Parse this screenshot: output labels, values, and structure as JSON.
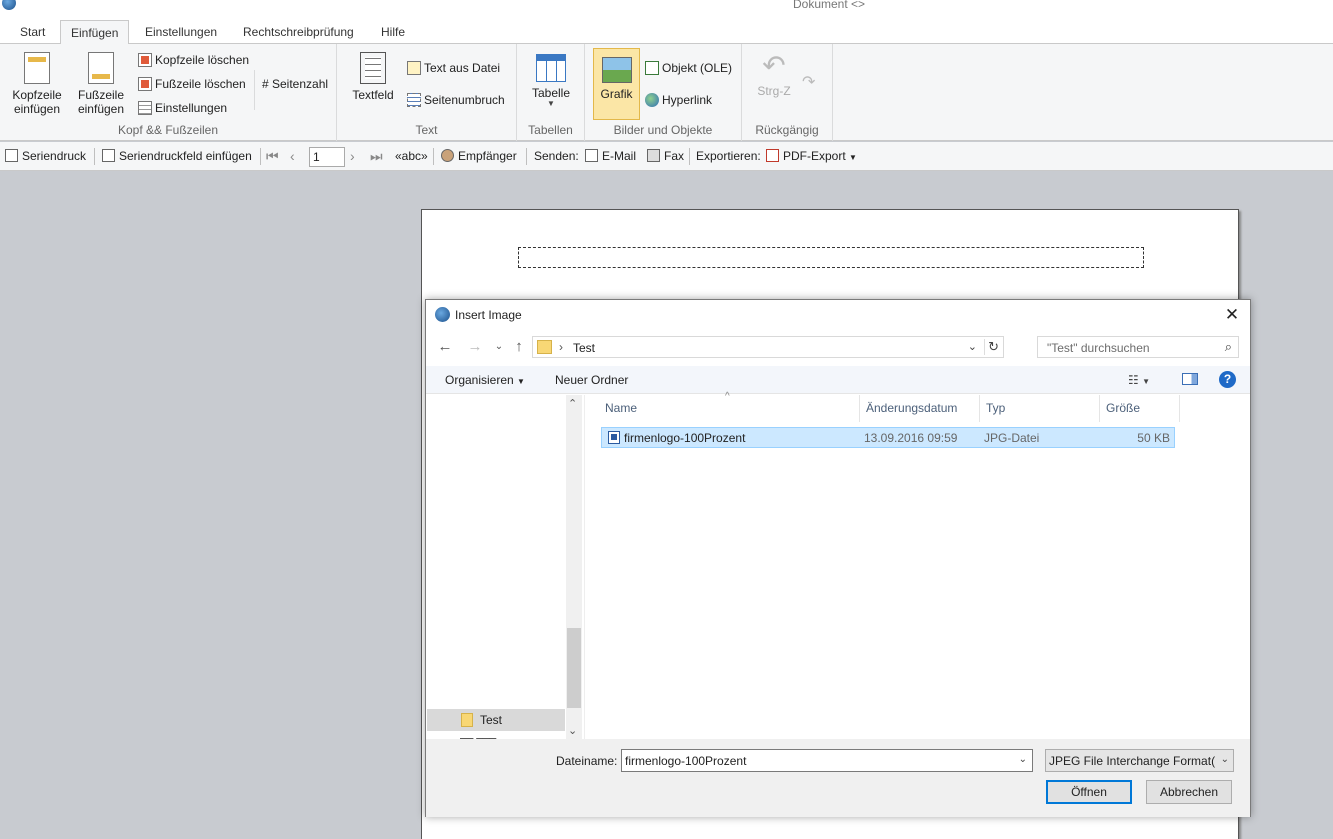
{
  "window": {
    "title": "Dokument <>"
  },
  "tabs": [
    {
      "label": "Start"
    },
    {
      "label": "Einfügen"
    },
    {
      "label": "Einstellungen"
    },
    {
      "label": "Rechtschreibprüfung"
    },
    {
      "label": "Hilfe"
    }
  ],
  "ribbon": {
    "header_footer": {
      "group_label": "Kopf && Fußzeilen",
      "insert_header": "Kopfzeile einfügen",
      "insert_footer": "Fußzeile einfügen",
      "delete_header": "Kopfzeile löschen",
      "delete_footer": "Fußzeile löschen",
      "settings": "Einstellungen",
      "page_number": "# Seitenzahl"
    },
    "text": {
      "group_label": "Text",
      "textbox": "Textfeld",
      "text_from_file": "Text aus Datei",
      "page_break": "Seitenumbruch"
    },
    "tables": {
      "group_label": "Tabellen",
      "table": "Tabelle"
    },
    "images": {
      "group_label": "Bilder und Objekte",
      "graphic": "Grafik",
      "object": "Objekt (OLE)",
      "hyperlink": "Hyperlink"
    },
    "undo": {
      "group_label": "Rückgängig",
      "undo": "Strg-Z"
    }
  },
  "toolbar": {
    "mail_merge": "Seriendruck",
    "insert_merge_field": "Seriendruckfeld einfügen",
    "page_value": "1",
    "abc": "«abc»",
    "recipients": "Empfänger",
    "send_label": "Senden:",
    "email": "E-Mail",
    "fax": "Fax",
    "export_label": "Exportieren:",
    "pdf_export": "PDF-Export"
  },
  "dialog": {
    "title": "Insert Image",
    "path": "Test",
    "search_placeholder": "\"Test\" durchsuchen",
    "organize": "Organisieren",
    "new_folder": "Neuer Ordner",
    "columns": [
      "Name",
      "Änderungsdatum",
      "Typ",
      "Größe"
    ],
    "nav_items": [
      {
        "label": "Test"
      }
    ],
    "files": [
      {
        "name": "firmenlogo-100Prozent",
        "date": "13.09.2016 09:59",
        "type": "JPG-Datei",
        "size": "50 KB"
      }
    ],
    "filename_label": "Dateiname:",
    "filename_value": "firmenlogo-100Prozent",
    "filter_value": "JPEG File Interchange Format(J",
    "open": "Öffnen",
    "cancel": "Abbrechen"
  }
}
